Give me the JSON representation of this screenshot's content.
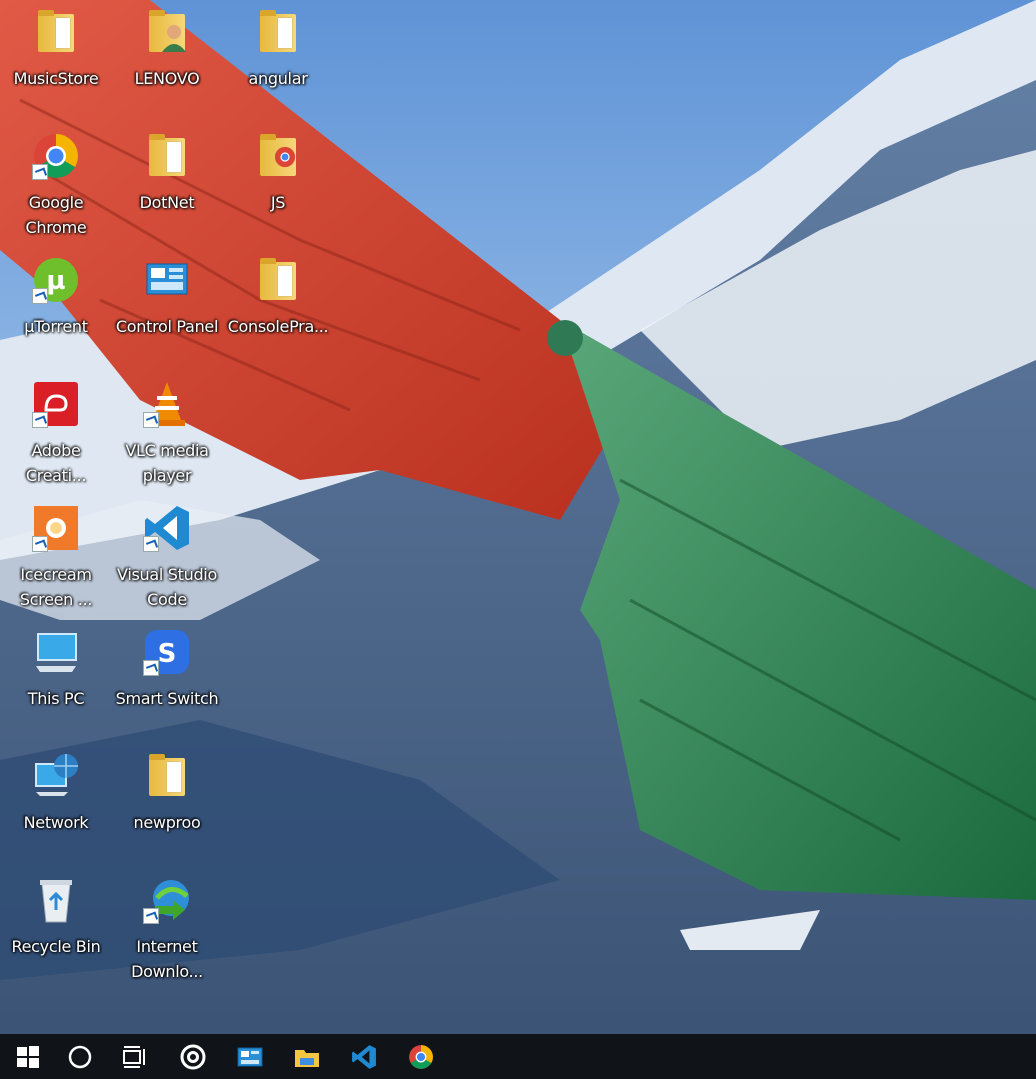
{
  "desktop": {
    "icons": [
      {
        "label": "MusicStore",
        "icon": "folder-icon"
      },
      {
        "label": "LENOVO",
        "icon": "user-folder-icon"
      },
      {
        "label": "angular",
        "icon": "folder-icon"
      },
      {
        "label": "Google Chrome",
        "icon": "chrome-icon"
      },
      {
        "label": "DotNet",
        "icon": "folder-icon"
      },
      {
        "label": "JS",
        "icon": "chrome-folder-icon"
      },
      {
        "label": "µTorrent",
        "icon": "utorrent-icon"
      },
      {
        "label": "Control Panel",
        "icon": "control-panel-icon"
      },
      {
        "label": "ConsolePra...",
        "icon": "folder-icon"
      },
      {
        "label": "Adobe Creati...",
        "icon": "adobe-cc-icon"
      },
      {
        "label": "VLC media player",
        "icon": "vlc-icon"
      },
      {
        "label": "Icecream Screen ...",
        "icon": "icecream-icon"
      },
      {
        "label": "Visual Studio Code",
        "icon": "vscode-icon"
      },
      {
        "label": "This PC",
        "icon": "this-pc-icon"
      },
      {
        "label": "Smart Switch",
        "icon": "smart-switch-icon"
      },
      {
        "label": "Network",
        "icon": "network-icon"
      },
      {
        "label": "newproo",
        "icon": "folder-icon"
      },
      {
        "label": "Recycle Bin",
        "icon": "recycle-bin-icon"
      },
      {
        "label": "Internet Downlo...",
        "icon": "idm-icon"
      }
    ]
  },
  "taskbar": {
    "items": [
      {
        "name": "start",
        "icon": "windows-logo-icon"
      },
      {
        "name": "search",
        "icon": "cortana-circle-icon"
      },
      {
        "name": "task-view",
        "icon": "task-view-icon"
      },
      {
        "name": "app-ring",
        "icon": "ring-icon"
      },
      {
        "name": "control-panel",
        "icon": "control-panel-icon"
      },
      {
        "name": "file-explorer",
        "icon": "file-explorer-icon"
      },
      {
        "name": "vscode",
        "icon": "vscode-icon"
      },
      {
        "name": "chrome",
        "icon": "chrome-icon"
      }
    ]
  },
  "colors": {
    "taskbar": "#101418",
    "flag_red": "#d9432f",
    "flag_green": "#1e7a46",
    "sky": "#7aa8e0"
  }
}
